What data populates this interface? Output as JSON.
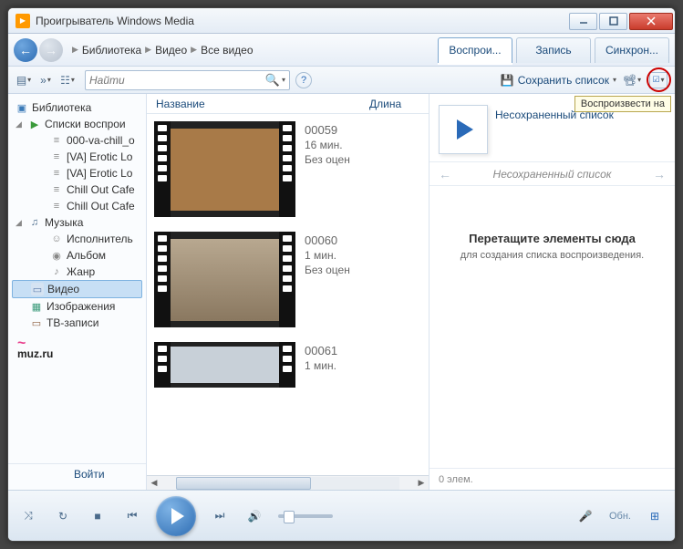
{
  "titlebar": {
    "title": "Проигрыватель Windows Media"
  },
  "breadcrumb": {
    "items": [
      "Библиотека",
      "Видео",
      "Все видео"
    ]
  },
  "tabs": {
    "play": "Воспрои...",
    "burn": "Запись",
    "sync": "Синхрон..."
  },
  "toolbar": {
    "search_placeholder": "Найти",
    "save_list": "Сохранить список",
    "tooltip": "Воспроизвести на"
  },
  "sidebar": {
    "library": "Библиотека",
    "playlists": "Списки воспрои",
    "pl_items": [
      "000-va-chill_o",
      "[VA] Erotic Lo",
      "[VA] Erotic Lo",
      "Chill Out Cafe",
      "Chill Out Cafe"
    ],
    "music": "Музыка",
    "music_items": [
      "Исполнитель",
      "Альбом",
      "Жанр"
    ],
    "video": "Видео",
    "images": "Изображения",
    "tv": "ТВ-записи",
    "muzru": "muz.ru",
    "signin": "Войти"
  },
  "listheader": {
    "name": "Название",
    "length": "Длина"
  },
  "videos": [
    {
      "id": "00059",
      "dur": "16 мин.",
      "rating": "Без оцен",
      "color": "#a87a48"
    },
    {
      "id": "00060",
      "dur": "1 мин.",
      "rating": "Без оцен",
      "color": "#b8a890"
    },
    {
      "id": "00061",
      "dur": "1 мин.",
      "rating": "",
      "color": "#c8d0d8"
    }
  ],
  "rightpane": {
    "title": "Несохраненный список",
    "subtitle": "Несохраненный список",
    "drop_main": "Перетащите элементы сюда",
    "drop_sub": "для создания списка воспроизведения.",
    "footer": "0 элем."
  },
  "controls": {
    "update": "Обн."
  }
}
